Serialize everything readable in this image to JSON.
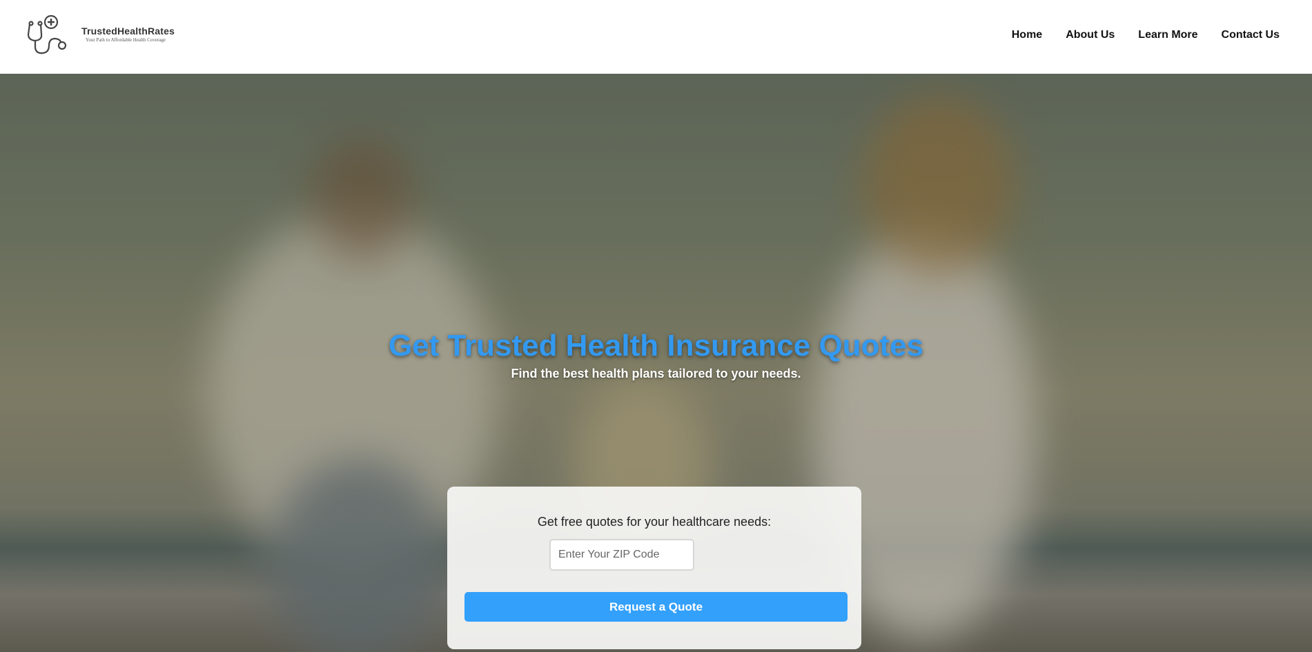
{
  "header": {
    "brand_name": "TrustedHealthRates",
    "tagline": "Your Path to Affordable Health Coverage",
    "nav": [
      {
        "label": "Home"
      },
      {
        "label": "About Us"
      },
      {
        "label": "Learn More"
      },
      {
        "label": "Contact Us"
      }
    ]
  },
  "hero": {
    "title": "Get Trusted Health Insurance Quotes",
    "subtitle": "Find the best health plans tailored to your needs.",
    "title_color": "#3399f0"
  },
  "quote_form": {
    "label": "Get free quotes for your healthcare needs:",
    "zip_placeholder": "Enter Your ZIP Code",
    "zip_value": "",
    "submit_label": "Request a Quote",
    "button_color": "#33a0fb"
  }
}
